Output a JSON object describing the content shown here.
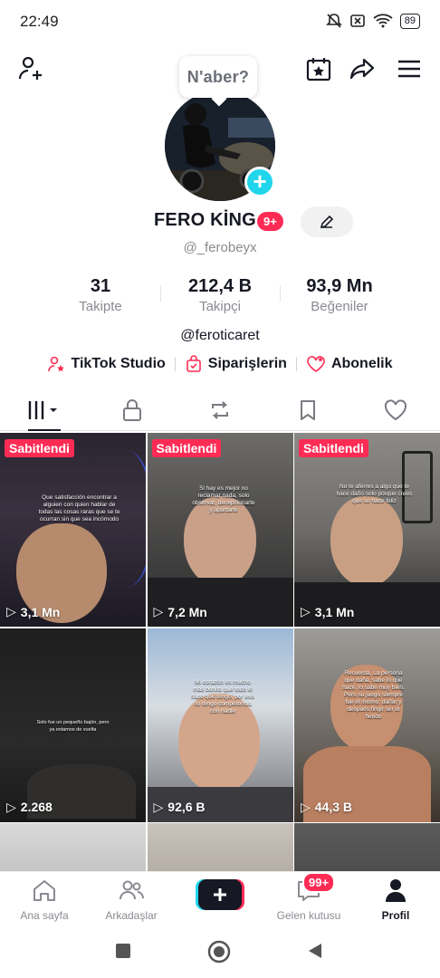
{
  "status": {
    "time": "22:49",
    "battery": "89"
  },
  "speech_bubble": "N'aber?",
  "profile": {
    "name": "FERO KİNG",
    "badge": "9+",
    "handle": "@_ferobeyx",
    "bio": "@feroticaret"
  },
  "stats": [
    {
      "value": "31",
      "label": "Takipte"
    },
    {
      "value": "212,4 B",
      "label": "Takipçi"
    },
    {
      "value": "93,9 Mn",
      "label": "Beğeniler"
    }
  ],
  "links": {
    "studio": "TikTok Studio",
    "orders": "Siparişlerin",
    "subscription": "Abonelik"
  },
  "videos": [
    {
      "pinned": "Sabitlendi",
      "views": "3,1 Mn",
      "caption": "Que satisfacción encontrar a alguien con quien hablar de todas las cosas raras que se te ocurran sin que sea incómodo"
    },
    {
      "pinned": "Sabitlendi",
      "views": "7,2 Mn",
      "caption": "Si hay es mejor no reclamar nada, solo observar, decepcionarte y apartarte"
    },
    {
      "pinned": "Sabitlendi",
      "views": "3,1 Mn",
      "caption": "No te aferres a algo que te hace daño solo porque crees que se hace feliz"
    },
    {
      "pinned": "",
      "views": "2.268",
      "caption": "Solo fue un pequeño bajón, pero ya estamos de vuelta"
    },
    {
      "pinned": "",
      "views": "92,6 B",
      "caption": "Mi corazón es mucho mas bonito que todo el flaco que tengo, por eso no tengo competencia con nadie"
    },
    {
      "pinned": "",
      "views": "44,3 B",
      "caption": "Recuerda, La persona que daña, sabe lo que hace, lo sabe muy bien. Pero su juego siempre fue el mismo: dañar y después fingir ser el herido"
    }
  ],
  "bottom_nav": {
    "home": "Ana sayfa",
    "friends": "Arkadaşlar",
    "inbox": "Gelen kutusu",
    "inbox_badge": "99+",
    "profile": "Profil"
  },
  "colors": {
    "accent": "#fe2c55",
    "cyan": "#20d5ec"
  }
}
